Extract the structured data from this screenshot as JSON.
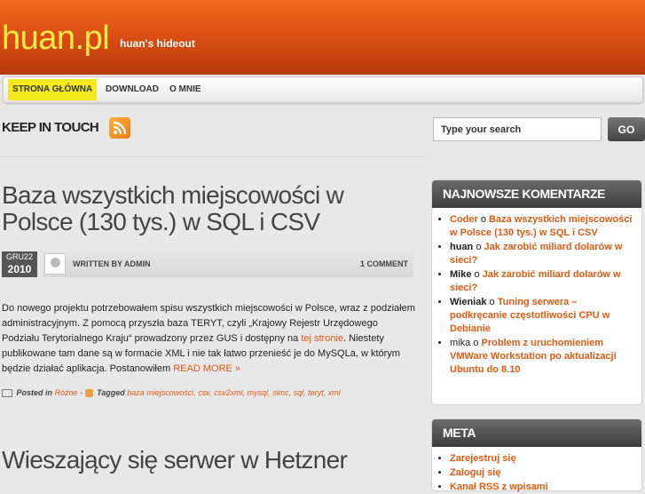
{
  "header": {
    "site_title": "huan.pl",
    "tagline": "huan's hideout"
  },
  "nav": {
    "items": [
      "STRONA GŁÓWNA",
      "DOWNLOAD",
      "O MNIE"
    ]
  },
  "keep_in_touch": "KEEP IN TOUCH",
  "search": {
    "placeholder": "Type your search",
    "button": "GO"
  },
  "posts": [
    {
      "title": "Baza wszystkich miejscowości w Polsce (130 tys.) w SQL i CSV",
      "date_day": "GRU22",
      "date_year": "2010",
      "written_by": "WRITTEN BY ADMIN",
      "comments": "1 COMMENT",
      "excerpt": "Do nowego projektu potrzebowałem spisu wszystkich miejscowości w Polsce, wraz z podziałem administracyjnym. Z pomocą przyszła baza TERYT, czyli „Krajowy Rejestr Urzędowego Podziału Terytorialnego Kraju“ prowadzony przez GUS i dostępny na",
      "excerpt_link": "tej stronie",
      "excerpt_cont": ". Niestety publikowane tam dane są w formacie XML i nie tak łatwo przenieść je do MySQLa, w którym będzie działać aplikacja. Postanowiłem",
      "read_more": "READ MORE »",
      "posted_in_label": "Posted in",
      "category": "Różne",
      "tagged_label": "Tagged",
      "tags": "baza miejscowości, csv, csv2xml, mysql, simc, sql, teryt, xml"
    },
    {
      "title": "Wieszający się serwer w Hetzner"
    }
  ],
  "sidebar": {
    "comments_title": "NAJNOWSZE KOMENTARZE",
    "comments": [
      {
        "author": "Coder",
        "sep": "o",
        "post": "Baza wszystkich miejscowości w Polsce (130 tys.) w SQL i CSV"
      },
      {
        "author": "huan",
        "sep": "o",
        "post": "Jak zarobić miliard dolarów w sieci?"
      },
      {
        "author": "Mike",
        "sep": "o",
        "post": "Jak zarobić miliard dolarów w sieci?"
      },
      {
        "author": "Wieniak",
        "sep": "o",
        "post": "Tuning serwera – podkręcanie częstotliwości CPU w Debianie"
      },
      {
        "author": "mika",
        "sep": "o",
        "post": "Problem z uruchomieniem VMWare Workstation po aktualizacji Ubuntu do 8.10"
      }
    ],
    "meta_title": "META",
    "meta_links": [
      "Zarejestruj się",
      "Zaloguj się",
      "Kanał RSS z wpisami"
    ]
  }
}
